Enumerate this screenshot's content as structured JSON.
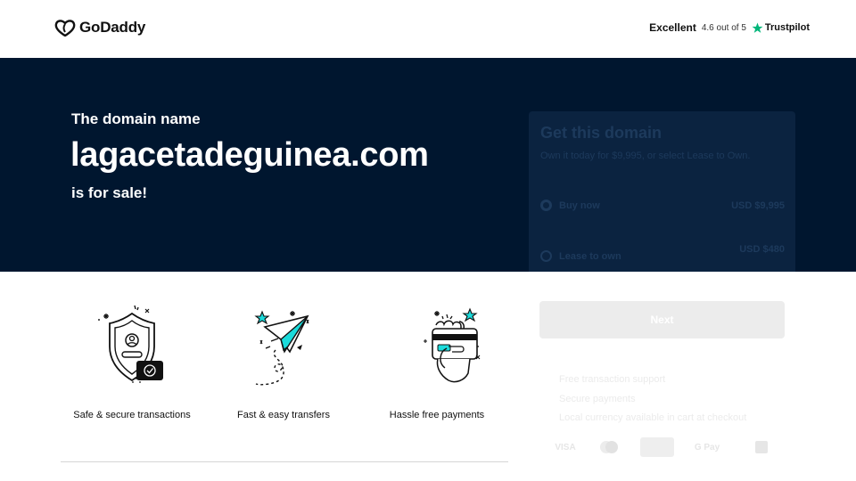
{
  "header": {
    "brand": "GoDaddy",
    "rating_label": "Excellent",
    "rating_score": "4.6 out of 5",
    "trustpilot": "Trustpilot"
  },
  "hero": {
    "pre": "The domain name",
    "domain": "lagacetadeguinea.com",
    "post": "is for sale!"
  },
  "panel": {
    "title": "Get this domain",
    "subtitle": "Own it today for $9,995, or select Lease to Own.",
    "options": [
      {
        "label": "Buy now",
        "price": "USD $9,995"
      },
      {
        "label": "Lease to own",
        "price": "USD $480"
      }
    ],
    "next_label": "Next",
    "benefits": [
      "Free transaction support",
      "Secure payments",
      "Local currency available in cart at checkout"
    ],
    "payments": [
      "VISA",
      "mastercard",
      "AMEX",
      "G Pay",
      "PayPal"
    ]
  },
  "features": [
    {
      "label": "Safe & secure transactions",
      "icon": "shield-icon"
    },
    {
      "label": "Fast & easy transfers",
      "icon": "paper-plane-icon"
    },
    {
      "label": "Hassle free payments",
      "icon": "card-hand-icon"
    }
  ],
  "colors": {
    "hero_bg": "#00162f",
    "accent_teal": "#1bdbdb"
  }
}
